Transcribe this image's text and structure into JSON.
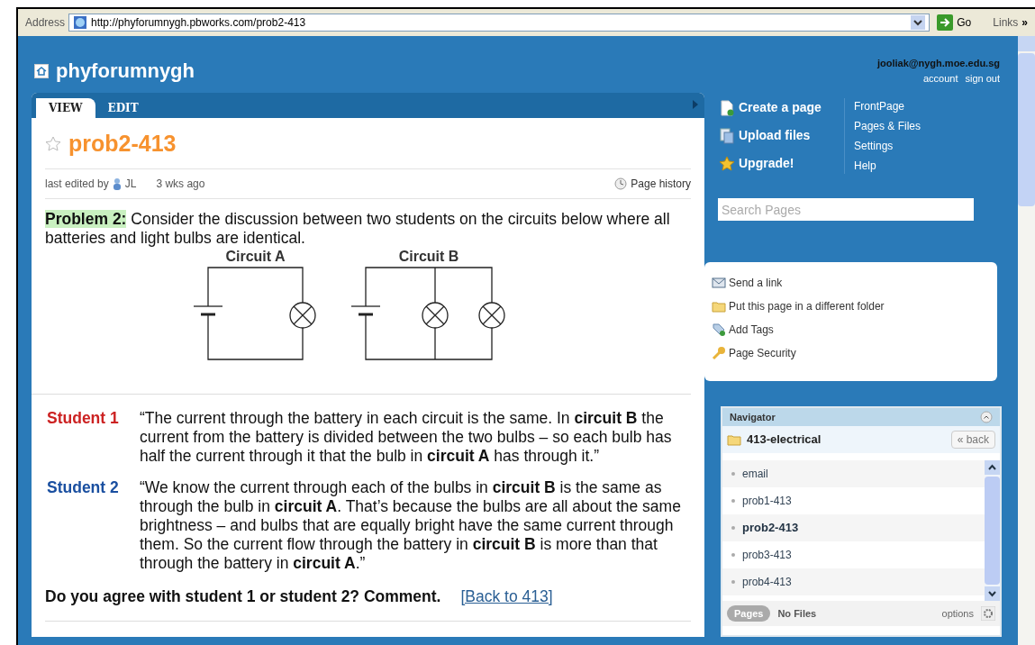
{
  "address_bar": {
    "label": "Address",
    "url": "http://phyforumnygh.pbworks.com/prob2-413",
    "go": "Go",
    "links": "Links",
    "more": "»"
  },
  "site": {
    "title": "phyforumnygh",
    "user": "jooliak@nygh.moe.edu.sg",
    "account": "account",
    "sign_out": "sign out"
  },
  "tabs": [
    {
      "label": "VIEW",
      "selected": true
    },
    {
      "label": "EDIT",
      "selected": false
    }
  ],
  "page": {
    "title": "prob2-413",
    "starred": false,
    "edited_by": "last edited by",
    "author": "JL",
    "edited_ago": "3 wks ago",
    "history": "Page history"
  },
  "problem": {
    "label": "Problem 2:",
    "text": "Consider the discussion between two students on the circuits below where all batteries and light bulbs are identical."
  },
  "circuits": [
    {
      "label": "Circuit A",
      "kind": "series"
    },
    {
      "label": "Circuit B",
      "kind": "parallel"
    }
  ],
  "statements": [
    {
      "label": "Student 1",
      "color": "#cc2222",
      "text": "“The current through the battery in each circuit is the same. In **circuit B**  the current from the battery is divided between the two bulbs – so each bulb has half the current through it that the bulb in **circuit A** has through it.”"
    },
    {
      "label": "Student 2",
      "color": "#1a4fa0",
      "text": "“We know the current through each of the bulbs in **circuit B** is the same as through the bulb in **circuit A**. That’s because the bulbs are all about the same brightness – and bulbs that are equally bright have the same current through them. So the current flow through the battery in **circuit B** is more than that through the battery in **circuit A**.”"
    }
  ],
  "question": "Do you agree with student 1 or student 2? Comment.",
  "back_link": "[Back to 413]",
  "actions": [
    {
      "label": "Create a page",
      "kind": "page"
    },
    {
      "label": "Upload files",
      "kind": "upload"
    },
    {
      "label": "Upgrade!",
      "kind": "star"
    }
  ],
  "menu": [
    "FrontPage",
    "Pages & Files",
    "Settings",
    "Help"
  ],
  "search": {
    "placeholder": "Search Pages"
  },
  "page_tools": [
    {
      "label": "Send a link",
      "kind": "mail"
    },
    {
      "label": "Put this page in a different folder",
      "kind": "folder"
    },
    {
      "label": "Add Tags",
      "kind": "tag"
    },
    {
      "label": "Page Security",
      "kind": "key"
    }
  ],
  "navigator": {
    "title": "Navigator",
    "folder": "413-electrical",
    "back": "« back",
    "items": [
      {
        "label": "email",
        "selected": false
      },
      {
        "label": "prob1-413",
        "selected": false
      },
      {
        "label": "prob2-413",
        "selected": true
      },
      {
        "label": "prob3-413",
        "selected": false
      },
      {
        "label": "prob4-413",
        "selected": false
      }
    ],
    "pages": "Pages",
    "files": "No Files",
    "options": "options"
  }
}
